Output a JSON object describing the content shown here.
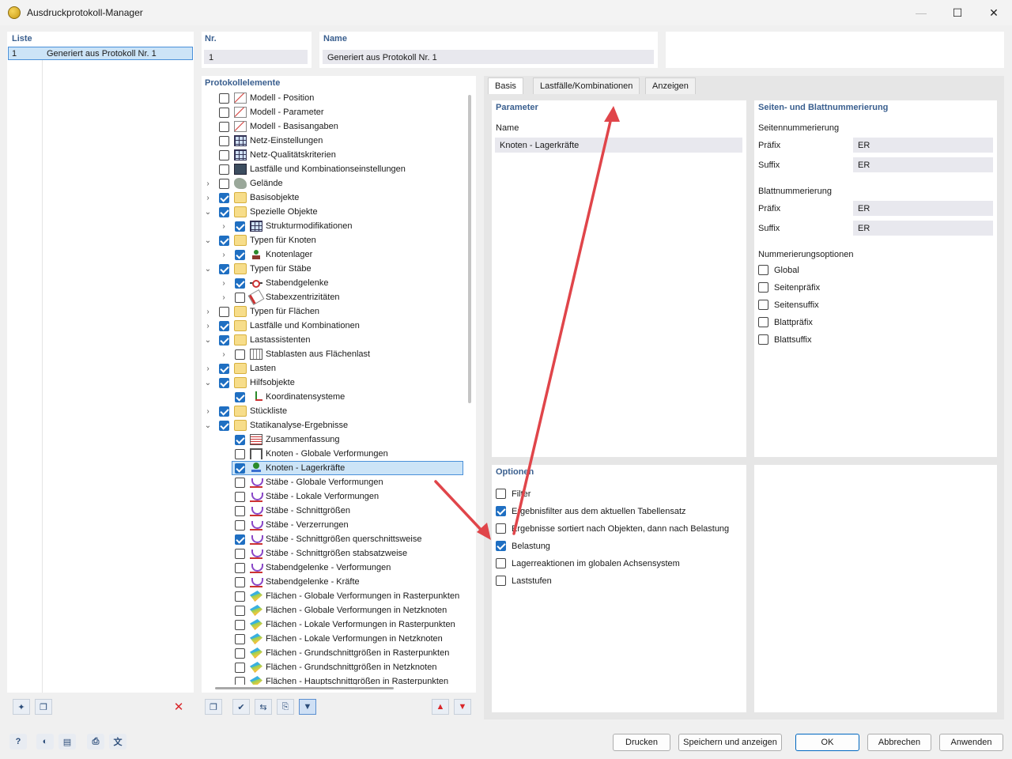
{
  "window": {
    "title": "Ausdruckprotokoll-Manager"
  },
  "list": {
    "header": "Liste",
    "rows": [
      {
        "nr": "1",
        "name": "Generiert aus Protokoll Nr. 1"
      }
    ]
  },
  "nr_field": {
    "label": "Nr.",
    "value": "1"
  },
  "name_field": {
    "label": "Name",
    "value": "Generiert aus Protokoll Nr. 1"
  },
  "tree": {
    "header": "Protokollelemente",
    "items": [
      {
        "label": "Modell - Position",
        "checked": false,
        "icon": "model-icon"
      },
      {
        "label": "Modell - Parameter",
        "checked": false,
        "icon": "model-icon"
      },
      {
        "label": "Modell - Basisangaben",
        "checked": false,
        "icon": "model-icon"
      },
      {
        "label": "Netz-Einstellungen",
        "checked": false,
        "icon": "mesh-icon"
      },
      {
        "label": "Netz-Qualitätskriterien",
        "checked": false,
        "icon": "mesh-icon"
      },
      {
        "label": "Lastfälle und Kombinationseinstellungen",
        "checked": false,
        "icon": "load-case-icon"
      },
      {
        "label": "Gelände",
        "checked": false,
        "icon": "terrain-icon",
        "chevron": "›"
      },
      {
        "label": "Basisobjekte",
        "checked": true,
        "icon": "folder-icon",
        "chevron": "›"
      },
      {
        "label": "Spezielle Objekte",
        "checked": true,
        "icon": "folder-icon",
        "chevron": "⌄"
      },
      {
        "label": "Strukturmodifikationen",
        "checked": true,
        "icon": "mesh-icon",
        "chevron": "›",
        "child": true
      },
      {
        "label": "Typen für Knoten",
        "checked": true,
        "icon": "folder-icon",
        "chevron": "⌄"
      },
      {
        "label": "Knotenlager",
        "checked": true,
        "icon": "node-support-icon",
        "chevron": "›",
        "child": true
      },
      {
        "label": "Typen für Stäbe",
        "checked": true,
        "icon": "folder-icon",
        "chevron": "⌄"
      },
      {
        "label": "Stabendgelenke",
        "checked": true,
        "icon": "hinge-icon",
        "chevron": "›",
        "child": true
      },
      {
        "label": "Stabexzentrizitäten",
        "checked": false,
        "icon": "eccentricity-icon",
        "chevron": "›",
        "child": true
      },
      {
        "label": "Typen für Flächen",
        "checked": false,
        "icon": "folder-icon",
        "chevron": "›"
      },
      {
        "label": "Lastfälle und Kombinationen",
        "checked": true,
        "icon": "folder-icon",
        "chevron": "›"
      },
      {
        "label": "Lastassistenten",
        "checked": true,
        "icon": "folder-icon",
        "chevron": "⌄"
      },
      {
        "label": "Stablasten aus Flächenlast",
        "checked": false,
        "icon": "load-generator-icon",
        "chevron": "›",
        "child": true
      },
      {
        "label": "Lasten",
        "checked": true,
        "icon": "folder-icon",
        "chevron": "›"
      },
      {
        "label": "Hilfsobjekte",
        "checked": true,
        "icon": "folder-icon",
        "chevron": "⌄"
      },
      {
        "label": "Koordinatensysteme",
        "checked": true,
        "icon": "coordinate-system-icon",
        "child": true
      },
      {
        "label": "Stückliste",
        "checked": true,
        "icon": "folder-icon",
        "chevron": "›"
      },
      {
        "label": "Statikanalyse-Ergebnisse",
        "checked": true,
        "icon": "folder-icon",
        "chevron": "⌄"
      },
      {
        "label": "Zusammenfassung",
        "checked": true,
        "icon": "summary-icon",
        "child": true
      },
      {
        "label": "Knoten - Globale Verformungen",
        "checked": false,
        "icon": "frame-icon",
        "child": true
      },
      {
        "label": "Knoten - Lagerkräfte",
        "checked": true,
        "icon": "reaction-icon",
        "child": true,
        "selected": true
      },
      {
        "label": "Stäbe - Globale Verformungen",
        "checked": false,
        "icon": "member-result-icon",
        "child": true
      },
      {
        "label": "Stäbe - Lokale Verformungen",
        "checked": false,
        "icon": "member-result-icon",
        "child": true
      },
      {
        "label": "Stäbe - Schnittgrößen",
        "checked": false,
        "icon": "member-result-icon",
        "child": true
      },
      {
        "label": "Stäbe - Verzerrungen",
        "checked": false,
        "icon": "member-result-icon",
        "child": true
      },
      {
        "label": "Stäbe - Schnittgrößen querschnittsweise",
        "checked": true,
        "icon": "member-result-icon",
        "child": true
      },
      {
        "label": "Stäbe - Schnittgrößen stabsatzweise",
        "checked": false,
        "icon": "member-result-icon",
        "child": true
      },
      {
        "label": "Stabendgelenke - Verformungen",
        "checked": false,
        "icon": "member-result-icon",
        "child": true
      },
      {
        "label": "Stabendgelenke - Kräfte",
        "checked": false,
        "icon": "member-result-icon",
        "child": true
      },
      {
        "label": "Flächen - Globale Verformungen in Rasterpunkten",
        "checked": false,
        "icon": "surface-result-icon",
        "child": true
      },
      {
        "label": "Flächen - Globale Verformungen in Netzknoten",
        "checked": false,
        "icon": "surface-result-icon",
        "child": true
      },
      {
        "label": "Flächen - Lokale Verformungen in Rasterpunkten",
        "checked": false,
        "icon": "surface-result-icon",
        "child": true
      },
      {
        "label": "Flächen - Lokale Verformungen in Netzknoten",
        "checked": false,
        "icon": "surface-result-icon",
        "child": true
      },
      {
        "label": "Flächen - Grundschnittgrößen in Rasterpunkten",
        "checked": false,
        "icon": "surface-result-icon",
        "child": true
      },
      {
        "label": "Flächen - Grundschnittgrößen in Netzknoten",
        "checked": false,
        "icon": "surface-result-icon",
        "child": true
      },
      {
        "label": "Flächen - Hauptschnittgrößen in Rasterpunkten",
        "checked": false,
        "icon": "surface-result-icon",
        "child": true
      }
    ]
  },
  "tabs": [
    {
      "label": "Basis",
      "active": true
    },
    {
      "label": "Lastfälle/Kombinationen",
      "active": false
    },
    {
      "label": "Anzeigen",
      "active": false
    }
  ],
  "parameter": {
    "header": "Parameter",
    "name_label": "Name",
    "name_value": "Knoten - Lagerkräfte"
  },
  "numbering": {
    "header": "Seiten- und Blattnummerierung",
    "page_header": "Seitennummerierung",
    "page_prefix_label": "Präfix",
    "page_prefix_value": "ER",
    "page_suffix_label": "Suffix",
    "page_suffix_value": "ER",
    "sheet_header": "Blattnummerierung",
    "sheet_prefix_label": "Präfix",
    "sheet_prefix_value": "ER",
    "sheet_suffix_label": "Suffix",
    "sheet_suffix_value": "ER",
    "options_header": "Nummerierungsoptionen",
    "options": [
      {
        "label": "Global",
        "checked": false
      },
      {
        "label": "Seitenpräfix",
        "checked": false
      },
      {
        "label": "Seitensuffix",
        "checked": false
      },
      {
        "label": "Blattpräfix",
        "checked": false
      },
      {
        "label": "Blattsuffix",
        "checked": false
      }
    ]
  },
  "options": {
    "header": "Optionen",
    "items": [
      {
        "label": "Filter",
        "checked": false
      },
      {
        "label": "Ergebnisfilter aus dem aktuellen Tabellensatz",
        "checked": true
      },
      {
        "label": "Ergebnisse sortiert nach Objekten, dann nach Belastung",
        "checked": false
      },
      {
        "label": "Belastung",
        "checked": true
      },
      {
        "label": "Lagerreaktionen im globalen Achsensystem",
        "checked": false
      },
      {
        "label": "Laststufen",
        "checked": false
      }
    ]
  },
  "buttons": {
    "print": "Drucken",
    "save_show": "Speichern und anzeigen",
    "ok": "OK",
    "cancel": "Abbrechen",
    "apply": "Anwenden"
  },
  "colors": {
    "accent": "#1f6fc2",
    "header": "#3a5f8f",
    "arrow": "#e0454a",
    "selection": "#cce4f7"
  }
}
